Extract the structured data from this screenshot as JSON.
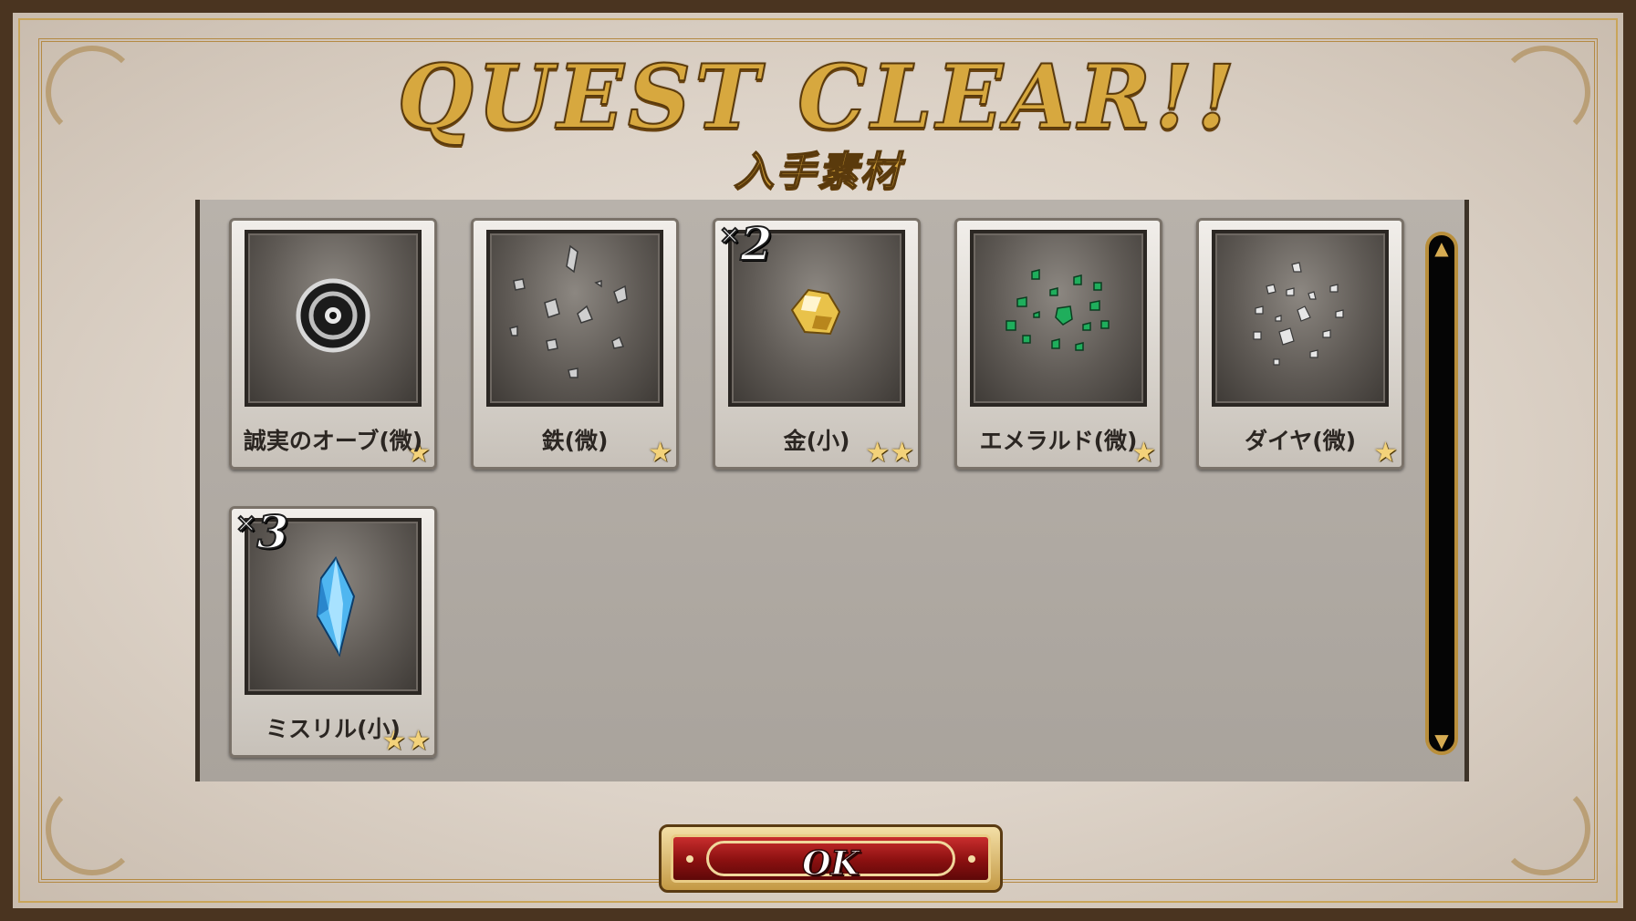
{
  "header": {
    "title": "QUEST CLEAR!!",
    "subtitle": "入手素材"
  },
  "items": [
    {
      "name": "誠実のオーブ(微)",
      "icon": "orb-icon",
      "stars": "★",
      "count": "",
      "count_prefix": ""
    },
    {
      "name": "鉄(微)",
      "icon": "iron-shards-icon",
      "stars": "★",
      "count": "",
      "count_prefix": ""
    },
    {
      "name": "金(小)",
      "icon": "gold-nugget-icon",
      "stars": "★★",
      "count": "2",
      "count_prefix": "×"
    },
    {
      "name": "エメラルド(微)",
      "icon": "emerald-shards-icon",
      "stars": "★",
      "count": "",
      "count_prefix": ""
    },
    {
      "name": "ダイヤ(微)",
      "icon": "diamond-shards-icon",
      "stars": "★",
      "count": "",
      "count_prefix": ""
    },
    {
      "name": "ミスリル(小)",
      "icon": "mythril-crystal-icon",
      "stars": "★★",
      "count": "3",
      "count_prefix": "×"
    }
  ],
  "buttons": {
    "ok_label": "OK"
  },
  "colors": {
    "title_gold": "#d7a83f",
    "ok_red": "#8a1010",
    "star": "#f3d27a"
  }
}
